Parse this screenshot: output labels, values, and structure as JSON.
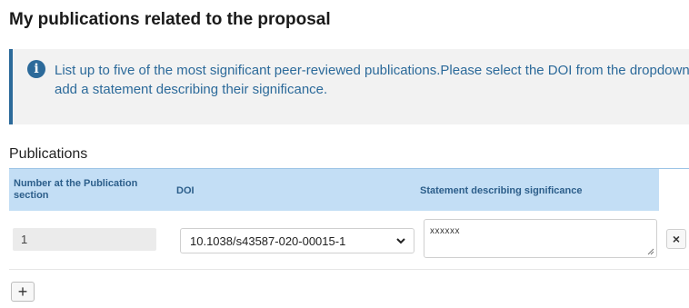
{
  "page": {
    "title": "My publications related to the proposal"
  },
  "info": {
    "icon": "info-icon",
    "text": "List up to five of the most significant peer-reviewed publications.Please select the DOI from the dropdown list and add a statement describing their significance."
  },
  "publications": {
    "section_label": "Publications",
    "columns": {
      "number": "Number at the Publication section",
      "doi": "DOI",
      "statement": "Statement describing significance"
    },
    "rows": [
      {
        "number": "1",
        "doi": "10.1038/s43587-020-00015-1",
        "statement": "xxxxxx",
        "remove_label": "×"
      }
    ],
    "add_label": "+"
  },
  "colors": {
    "accent": "#2c6a9a",
    "header_bg": "#c3def5",
    "info_bg": "#f2f2f2"
  }
}
